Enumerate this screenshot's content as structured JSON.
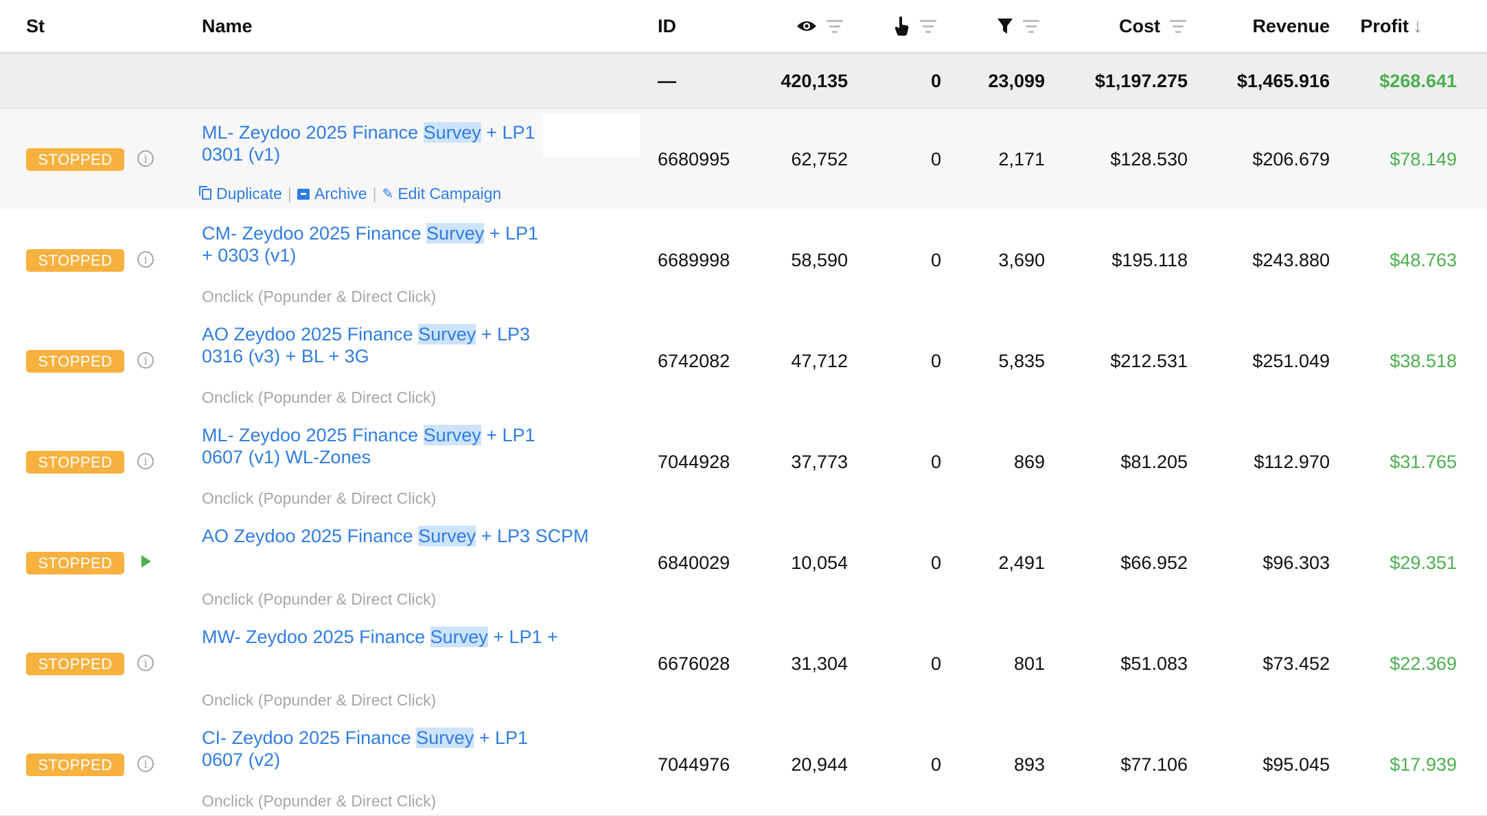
{
  "columns": {
    "status": "St",
    "name": "Name",
    "id": "ID",
    "cost": "Cost",
    "revenue": "Revenue",
    "profit": "Profit",
    "profit_sort_arrow": "↓",
    "views_icon": "eye-icon",
    "clicks_icon": "pointer-icon",
    "conversions_icon": "funnel-icon"
  },
  "totals": {
    "id": "—",
    "views": "420,135",
    "clicks": "0",
    "conversions": "23,099",
    "cost": "$1,197.275",
    "revenue": "$1,465.916",
    "profit": "$268.641"
  },
  "actions": {
    "duplicate": "Duplicate",
    "archive": "Archive",
    "edit": "Edit Campaign",
    "separator": "|"
  },
  "colors": {
    "status_badge": "#f7b13f",
    "link": "#2f7de1",
    "profit": "#4caf50",
    "highlight": "#cde3fa"
  },
  "rows": [
    {
      "status": "STOPPED",
      "status_icon": "info-icon",
      "name_lines": [
        [
          "ML- Zeydoo 2025 Finance ",
          "Survey",
          " + LP1"
        ],
        [
          "0301 (v1)",
          "",
          ""
        ]
      ],
      "subtitle": "",
      "id": "6680995",
      "views": "62,752",
      "clicks": "0",
      "conversions": "2,171",
      "cost": "$128.530",
      "revenue": "$206.679",
      "profit": "$78.149"
    },
    {
      "status": "STOPPED",
      "status_icon": "info-icon",
      "name_lines": [
        [
          "CM- Zeydoo 2025 Finance ",
          "Survey",
          " + LP1"
        ],
        [
          "+ 0303 (v1)",
          "",
          ""
        ]
      ],
      "subtitle": "Onclick (Popunder & Direct Click)",
      "id": "6689998",
      "views": "58,590",
      "clicks": "0",
      "conversions": "3,690",
      "cost": "$195.118",
      "revenue": "$243.880",
      "profit": "$48.763"
    },
    {
      "status": "STOPPED",
      "status_icon": "info-icon",
      "name_lines": [
        [
          "AO Zeydoo 2025 Finance ",
          "Survey",
          " + LP3"
        ],
        [
          "0316 (v3) + BL + 3G",
          "",
          ""
        ]
      ],
      "subtitle": "Onclick (Popunder & Direct Click)",
      "id": "6742082",
      "views": "47,712",
      "clicks": "0",
      "conversions": "5,835",
      "cost": "$212.531",
      "revenue": "$251.049",
      "profit": "$38.518"
    },
    {
      "status": "STOPPED",
      "status_icon": "info-icon",
      "name_lines": [
        [
          "ML- Zeydoo 2025 Finance ",
          "Survey",
          " + LP1"
        ],
        [
          "0607 (v1) WL-Zones",
          "",
          ""
        ]
      ],
      "subtitle": "Onclick (Popunder & Direct Click)",
      "id": "7044928",
      "views": "37,773",
      "clicks": "0",
      "conversions": "869",
      "cost": "$81.205",
      "revenue": "$112.970",
      "profit": "$31.765"
    },
    {
      "status": "STOPPED",
      "status_icon": "play-icon",
      "name_lines": [
        [
          "AO Zeydoo 2025 Finance ",
          "Survey",
          " + LP3 SCPM"
        ]
      ],
      "subtitle": "Onclick (Popunder & Direct Click)",
      "id": "6840029",
      "views": "10,054",
      "clicks": "0",
      "conversions": "2,491",
      "cost": "$66.952",
      "revenue": "$96.303",
      "profit": "$29.351"
    },
    {
      "status": "STOPPED",
      "status_icon": "info-icon",
      "name_lines": [
        [
          "MW- Zeydoo 2025 Finance ",
          "Survey",
          " + LP1 +"
        ]
      ],
      "subtitle": "Onclick (Popunder & Direct Click)",
      "id": "6676028",
      "views": "31,304",
      "clicks": "0",
      "conversions": "801",
      "cost": "$51.083",
      "revenue": "$73.452",
      "profit": "$22.369"
    },
    {
      "status": "STOPPED",
      "status_icon": "info-icon",
      "name_lines": [
        [
          "CI- Zeydoo 2025 Finance ",
          "Survey",
          " + LP1"
        ],
        [
          "0607 (v2)",
          "",
          ""
        ]
      ],
      "subtitle": "Onclick (Popunder & Direct Click)",
      "id": "7044976",
      "views": "20,944",
      "clicks": "0",
      "conversions": "893",
      "cost": "$77.106",
      "revenue": "$95.045",
      "profit": "$17.939"
    }
  ]
}
